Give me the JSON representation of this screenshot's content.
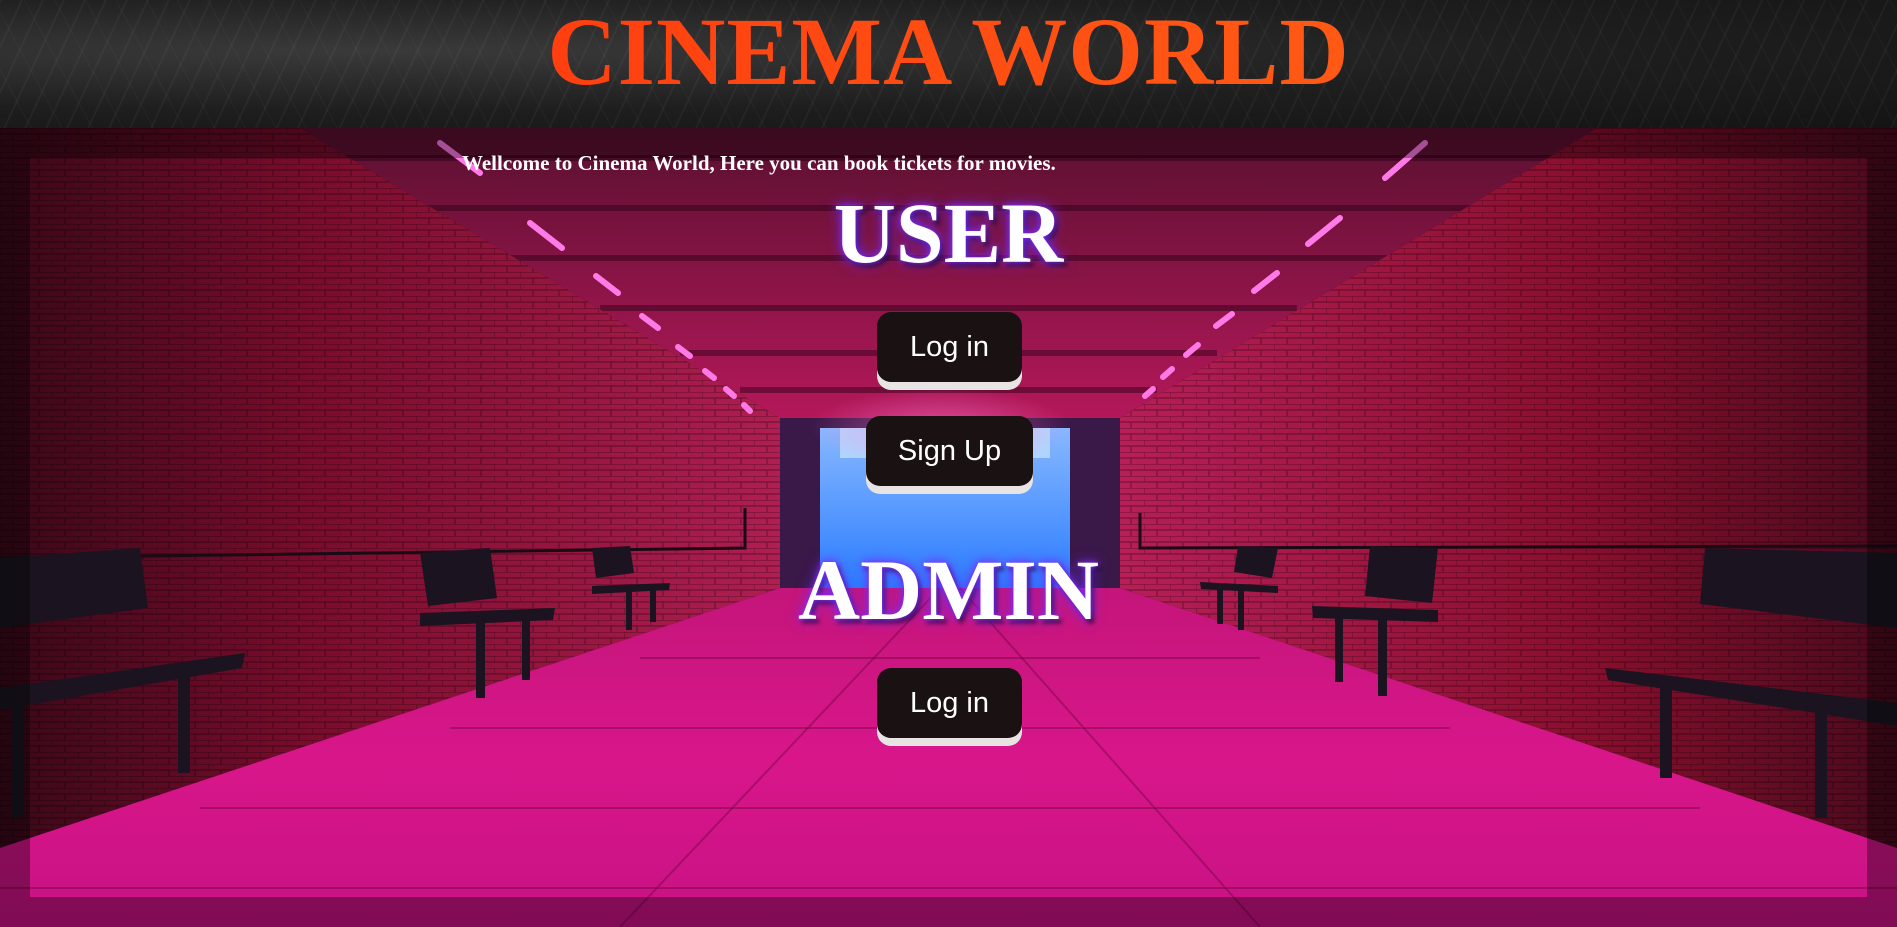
{
  "header": {
    "title": "CINEMA WORLD"
  },
  "welcome": {
    "text": "Wellcome to Cinema World, Here you can book tickets for movies."
  },
  "user_section": {
    "heading": "USER",
    "login_label": "Log in",
    "signup_label": "Sign Up"
  },
  "admin_section": {
    "heading": "ADMIN",
    "login_label": "Log in"
  },
  "colors": {
    "title_gradient_start": "#ff2a0a",
    "title_gradient_end": "#ff6a18",
    "button_bg": "#1a1212",
    "button_shadow": "#e9e4e4",
    "tunnel_magenta": "#e0127a",
    "tunnel_red": "#8a0a2a",
    "far_end_blue": "#3aa0ff"
  },
  "background": {
    "description_icon": "neon-tunnel-background"
  }
}
